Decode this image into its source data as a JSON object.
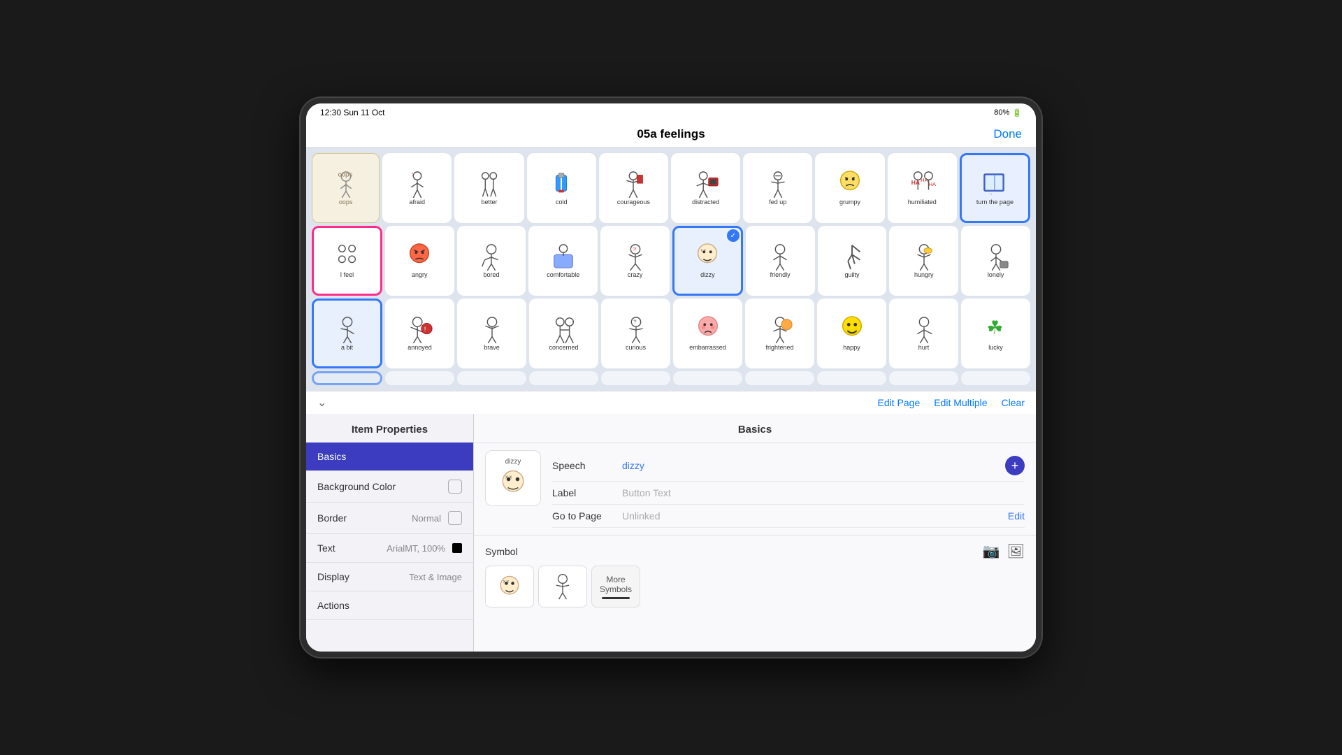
{
  "status_bar": {
    "time": "12:30",
    "date": "Sun 11 Oct",
    "battery": "80%"
  },
  "header": {
    "title": "05a feelings",
    "done_label": "Done"
  },
  "grid": {
    "rows": [
      [
        {
          "id": "oops",
          "label": "oops",
          "style": "oops"
        },
        {
          "id": "afraid",
          "label": "afraid",
          "style": "normal"
        },
        {
          "id": "better",
          "label": "better",
          "style": "normal"
        },
        {
          "id": "cold",
          "label": "cold",
          "style": "normal"
        },
        {
          "id": "courageous",
          "label": "courageous",
          "style": "normal"
        },
        {
          "id": "distracted",
          "label": "distracted",
          "style": "normal"
        },
        {
          "id": "fed-up",
          "label": "fed up",
          "style": "normal"
        },
        {
          "id": "grumpy",
          "label": "grumpy",
          "style": "normal"
        },
        {
          "id": "humiliated",
          "label": "humiliated",
          "style": "normal"
        },
        {
          "id": "turn-page",
          "label": "turn the page",
          "style": "turn-page"
        }
      ],
      [
        {
          "id": "i-feel",
          "label": "I feel",
          "style": "selected-pink"
        },
        {
          "id": "angry",
          "label": "angry",
          "style": "normal"
        },
        {
          "id": "bored",
          "label": "bored",
          "style": "normal"
        },
        {
          "id": "comfortable",
          "label": "comfortable",
          "style": "normal"
        },
        {
          "id": "crazy",
          "label": "crazy",
          "style": "normal"
        },
        {
          "id": "dizzy",
          "label": "dizzy",
          "style": "selected-blue checkmark"
        },
        {
          "id": "friendly",
          "label": "friendly",
          "style": "normal"
        },
        {
          "id": "guilty",
          "label": "guilty",
          "style": "normal"
        },
        {
          "id": "hungry",
          "label": "hungry",
          "style": "normal"
        },
        {
          "id": "lonely",
          "label": "lonely",
          "style": "normal"
        }
      ],
      [
        {
          "id": "a-bit",
          "label": "a bit",
          "style": "selected-blue"
        },
        {
          "id": "annoyed",
          "label": "annoyed",
          "style": "normal"
        },
        {
          "id": "brave",
          "label": "brave",
          "style": "normal"
        },
        {
          "id": "concerned",
          "label": "concerned",
          "style": "normal"
        },
        {
          "id": "curious",
          "label": "curious",
          "style": "normal"
        },
        {
          "id": "embarrassed",
          "label": "embarrassed",
          "style": "normal"
        },
        {
          "id": "frightened",
          "label": "frightened",
          "style": "normal"
        },
        {
          "id": "happy",
          "label": "happy",
          "style": "normal"
        },
        {
          "id": "hurt",
          "label": "hurt",
          "style": "normal"
        },
        {
          "id": "lucky",
          "label": "lucky",
          "style": "normal"
        }
      ],
      [
        {
          "id": "row4-1",
          "label": "...",
          "style": "selected-blue partial"
        },
        {
          "id": "row4-2",
          "label": "...",
          "style": "normal"
        },
        {
          "id": "row4-3",
          "label": "...",
          "style": "normal"
        },
        {
          "id": "row4-4",
          "label": "...",
          "style": "normal"
        },
        {
          "id": "row4-5",
          "label": "...",
          "style": "normal"
        },
        {
          "id": "row4-6",
          "label": "...",
          "style": "normal"
        },
        {
          "id": "row4-7",
          "label": "...",
          "style": "normal"
        },
        {
          "id": "row4-8",
          "label": "...",
          "style": "normal"
        },
        {
          "id": "row4-9",
          "label": "...",
          "style": "normal"
        },
        {
          "id": "row4-10",
          "label": "...",
          "style": "normal"
        }
      ]
    ]
  },
  "toolbar": {
    "edit_page_label": "Edit Page",
    "edit_multiple_label": "Edit Multiple",
    "clear_label": "Clear"
  },
  "left_panel": {
    "title": "Item Properties",
    "menu_items": [
      {
        "id": "basics",
        "label": "Basics",
        "value": "",
        "active": true
      },
      {
        "id": "background-color",
        "label": "Background Color",
        "value": "checkbox",
        "active": false
      },
      {
        "id": "border",
        "label": "Border",
        "value": "Normal",
        "active": false
      },
      {
        "id": "text",
        "label": "Text",
        "value": "ArialMT, 100%",
        "active": false
      },
      {
        "id": "display",
        "label": "Display",
        "value": "Text & Image",
        "active": false
      },
      {
        "id": "actions",
        "label": "Actions",
        "value": "",
        "active": false
      }
    ]
  },
  "right_panel": {
    "title": "Basics",
    "item": {
      "name": "dizzy",
      "speech_label": "Speech",
      "speech_value": "dizzy",
      "label_label": "Label",
      "label_placeholder": "Button Text",
      "goto_label": "Go to Page",
      "goto_value": "Unlinked"
    },
    "symbol": {
      "title": "Symbol",
      "thumbs": [
        "dizzy-1",
        "dizzy-2",
        "more"
      ]
    }
  }
}
